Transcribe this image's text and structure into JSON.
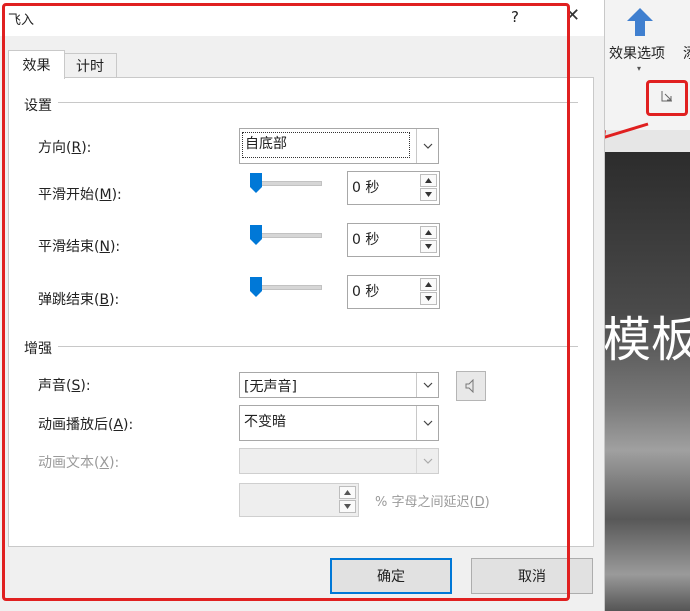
{
  "dialog": {
    "title": "飞入",
    "help": "?",
    "close": "✕",
    "tabs": [
      {
        "label": "效果"
      },
      {
        "label": "计时"
      }
    ],
    "settings": {
      "section_title": "设置",
      "direction": {
        "label_pre": "方向(",
        "key": "R",
        "label_post": "):",
        "value": "自底部"
      },
      "smooth_start": {
        "label_pre": "平滑开始(",
        "key": "M",
        "label_post": "):",
        "value": "0 秒",
        "slider_level": 0
      },
      "smooth_end": {
        "label_pre": "平滑结束(",
        "key": "N",
        "label_post": "):",
        "value": "0 秒",
        "slider_level": 0
      },
      "bounce_end": {
        "label_pre": "弹跳结束(",
        "key": "B",
        "label_post": "):",
        "value": "0 秒",
        "slider_level": 0
      }
    },
    "enhance": {
      "section_title": "增强",
      "sound": {
        "label_pre": "声音(",
        "key": "S",
        "label_post": "):",
        "value": "[无声音]"
      },
      "after_animation": {
        "label_pre": "动画播放后(",
        "key": "A",
        "label_post": "):",
        "value": "不变暗"
      },
      "animate_text": {
        "label_pre": "动画文本(",
        "key": "X",
        "label_post": "):",
        "value": ""
      },
      "delay_label_pre": "% 字母之间延迟(",
      "delay_key": "D",
      "delay_label_post": ")"
    },
    "ok_label": "确定",
    "cancel_label": "取消"
  },
  "ribbon": {
    "effect_options_label": "效果选项",
    "partial_label": "添",
    "slide_text": "模板"
  },
  "colors": {
    "accent": "#0078d7",
    "highlight": "#e02020",
    "arrow_icon": "#3f7fcf"
  }
}
